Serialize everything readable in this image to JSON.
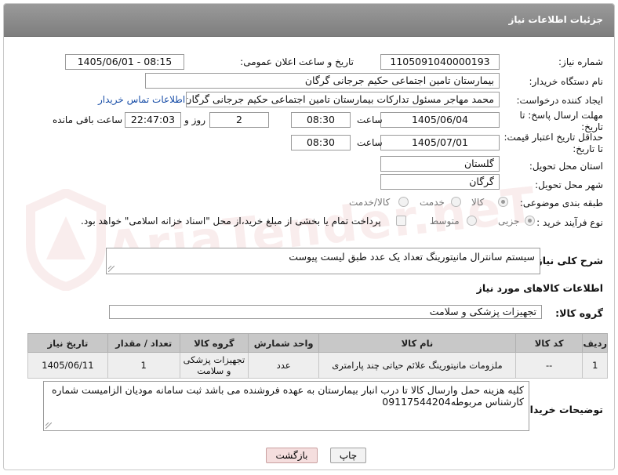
{
  "header": {
    "title": "جزئیات اطلاعات نیاز"
  },
  "form": {
    "need_number_label": "شماره نیاز:",
    "need_number": "1105091040000193",
    "announce_label": "تاریخ و ساعت اعلان عمومی:",
    "announce_value": "1405/06/01 - 08:15",
    "buyer_org_label": "نام دستگاه خریدار:",
    "buyer_org": "بیمارستان تامین اجتماعی حکیم جرجانی گرگان",
    "requester_label": "ایجاد کننده درخواست:",
    "requester": "محمد مهاجر مسئول تدارکات بیمارستان تامین اجتماعی حکیم جرجانی گرگان",
    "contact_link": "اطلاعات تماس خریدار",
    "deadline_label": "مهلت ارسال پاسخ: تا تاریخ:",
    "deadline_date": "1405/06/04",
    "time_label": "ساعت",
    "deadline_time": "08:30",
    "days_value": "2",
    "days_label": "روز و",
    "remaining_time": "22:47:03",
    "remaining_label": "ساعت باقی مانده",
    "price_valid_label": "حداقل تاریخ اعتبار قیمت: تا تاریخ:",
    "price_valid_date": "1405/07/01",
    "price_valid_time": "08:30",
    "province_label": "استان محل تحویل:",
    "province": "گلستان",
    "city_label": "شهر محل تحویل:",
    "city": "گرگان",
    "category_label": "طبقه بندی موضوعی:",
    "category_options": [
      "کالا",
      "خدمت",
      "کالا/خدمت"
    ],
    "process_label": "نوع فرآیند خرید :",
    "process_options": [
      "جزیی",
      "متوسط"
    ],
    "payment_note": "پرداخت تمام یا بخشی از مبلغ خرید،از محل \"اسناد خزانه اسلامی\" خواهد بود.",
    "summary_label": "شرح کلی نیاز:",
    "summary": "سیستم سانترال مانیتورینگ تعداد یک عدد طبق لیست پیوست",
    "goods_info_heading": "اطلاعات کالاهای مورد نیاز",
    "goods_group_label": "گروه کالا:",
    "goods_group": "تجهیزات پزشکی و سلامت"
  },
  "table": {
    "headers": [
      "ردیف",
      "کد کالا",
      "نام کالا",
      "واحد شمارش",
      "گروه کالا",
      "تعداد / مقدار",
      "تاریخ نیاز"
    ],
    "rows": [
      [
        "1",
        "--",
        "ملزومات مانیتورینگ علائم حیاتی چند پارامتری",
        "عدد",
        "تجهیزات پزشکی و سلامت",
        "1",
        "1405/06/11"
      ]
    ]
  },
  "notes": {
    "label": "توضیحات خریدار:",
    "text": "کلیه هزینه حمل وارسال کالا تا درب انبار بیمارستان به عهده فروشنده می باشد ثبت سامانه مودیان الزامیست شماره کارشناس مربوطه09117544204"
  },
  "buttons": {
    "print": "چاپ",
    "back": "بازگشت"
  },
  "watermark": {
    "text": "AriaTender.neT"
  },
  "colors": {
    "titlebar": "#8a8a8a",
    "link": "#1a4fa8",
    "back_button": "#f5dede",
    "table_header": "#c8c8c8"
  }
}
